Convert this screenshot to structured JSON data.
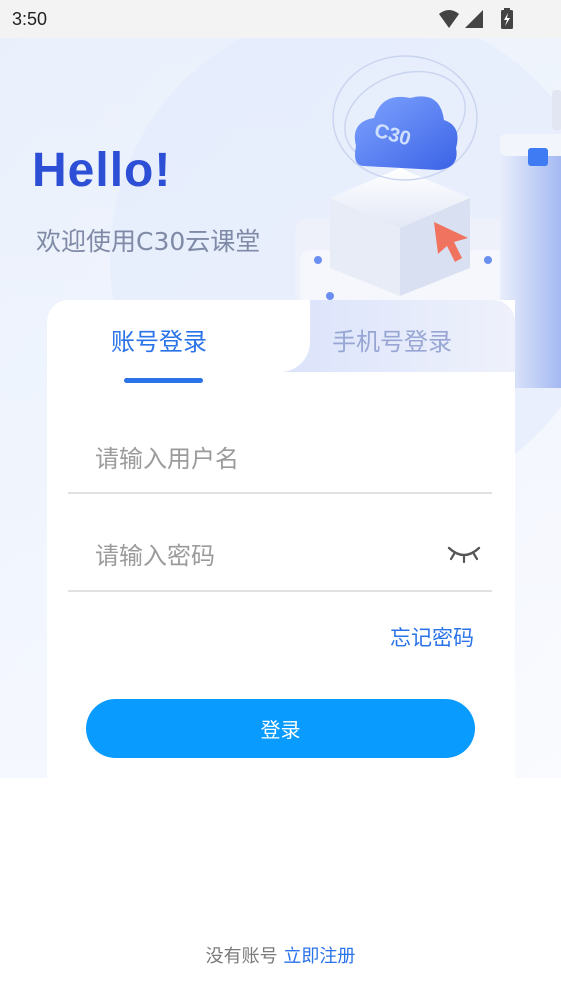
{
  "status_bar": {
    "time": "3:50",
    "icons": [
      "wifi-icon",
      "signal-icon",
      "battery-charging-icon"
    ]
  },
  "hero": {
    "title": "Hello!",
    "subtitle": "欢迎使用C30云课堂",
    "cloud_badge": "C30"
  },
  "tabs": [
    {
      "label": "账号登录",
      "active": true
    },
    {
      "label": "手机号登录",
      "active": false
    }
  ],
  "form": {
    "username_placeholder": "请输入用户名",
    "password_placeholder": "请输入密码",
    "password_visibility_icon": "eye-closed-icon",
    "forgot_label": "忘记密码",
    "login_label": "登录"
  },
  "footer": {
    "text": "没有账号",
    "link": "立即注册"
  },
  "colors": {
    "accent": "#2a73e8",
    "title": "#2d4fd6",
    "button": "#0a9bff"
  }
}
